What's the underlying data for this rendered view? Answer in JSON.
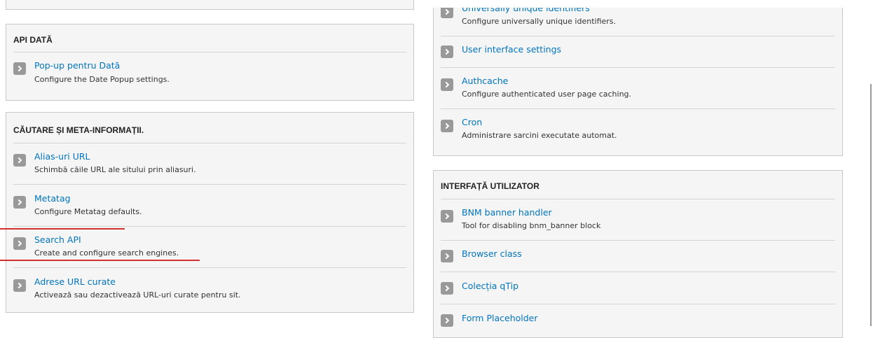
{
  "left_panels": {
    "api_data": {
      "title": "API DATĂ",
      "items": [
        {
          "label": "Pop-up pentru Dată",
          "desc": "Configure the Date Popup settings."
        }
      ]
    },
    "search_meta": {
      "title": "CĂUTARE ȘI META-INFORMAȚII.",
      "items": [
        {
          "label": "Alias-uri URL",
          "desc": "Schimbă căile URL ale sitului prin aliasuri."
        },
        {
          "label": "Metatag",
          "desc": "Configure Metatag defaults."
        },
        {
          "label": "Search API",
          "desc": "Create and configure search engines."
        },
        {
          "label": "Adrese URL curate",
          "desc": "Activează sau dezactivează URL-uri curate pentru sit."
        }
      ]
    }
  },
  "right_panels": {
    "system": {
      "items": [
        {
          "label": "Universally unique identifiers",
          "desc": "Configure universally unique identifiers."
        },
        {
          "label": "User interface settings",
          "desc": ""
        },
        {
          "label": "Authcache",
          "desc": "Configure authenticated user page caching."
        },
        {
          "label": "Cron",
          "desc": "Administrare sarcini executate automat."
        }
      ]
    },
    "ui": {
      "title": "INTERFAȚĂ UTILIZATOR",
      "items": [
        {
          "label": "BNM banner handler",
          "desc": "Tool for disabling bnm_banner block"
        },
        {
          "label": "Browser class",
          "desc": ""
        },
        {
          "label": "Colecția qTip",
          "desc": ""
        },
        {
          "label": "Form Placeholder",
          "desc": ""
        }
      ]
    }
  },
  "colors": {
    "link": "#0074bd",
    "annotation_underline": "#d32f2f",
    "panel_bg": "#f5f5f5",
    "chevron_bg": "#999999"
  },
  "icons": {
    "item_bullet": "chevron-right-icon"
  }
}
